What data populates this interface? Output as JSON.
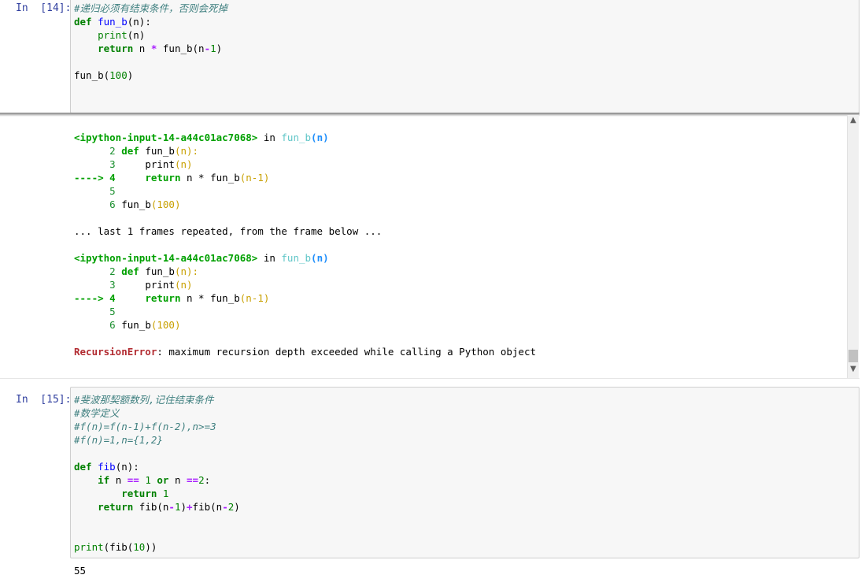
{
  "cell14": {
    "prompt": "In  [14]:",
    "comment": "#递归必须有结束条件，否则会死掉",
    "def_kw": "def",
    "fn_name": "fun_b",
    "def_args": "(n):",
    "print_fn": "print",
    "print_args": "(n)",
    "return_kw": "return",
    "return_n": " n ",
    "star": "*",
    "return_call": " fun_b(n",
    "minus": "-",
    "one": "1",
    "close": ")",
    "call_name": "fun_b(",
    "call_arg": "100",
    "call_close": ")"
  },
  "traceback": {
    "frames": [
      {
        "header_file": "<ipython-input-14-a44c01ac7068>",
        "header_in": " in ",
        "header_fn": "fun_b",
        "header_args": "(n)",
        "lines": [
          {
            "num": "      2",
            "code_kw": "def",
            "code_rest": " fun_b",
            "code_paren": "(n):"
          },
          {
            "num": "      3",
            "code_kw": "",
            "code_rest": "     print",
            "code_paren": "(n)"
          },
          {
            "num": "----> 4",
            "code_kw": "     return",
            "code_rest": " n * fun_b",
            "code_paren": "(n-1)"
          },
          {
            "num": "      5",
            "code_kw": "",
            "code_rest": "",
            "code_paren": ""
          },
          {
            "num": "      6",
            "code_kw": "",
            "code_rest": " fun_b",
            "code_paren": "(100)"
          }
        ]
      },
      {
        "header_file": "<ipython-input-14-a44c01ac7068>",
        "header_in": " in ",
        "header_fn": "fun_b",
        "header_args": "(n)",
        "lines": [
          {
            "num": "      2",
            "code_kw": "def",
            "code_rest": " fun_b",
            "code_paren": "(n):"
          },
          {
            "num": "      3",
            "code_kw": "",
            "code_rest": "     print",
            "code_paren": "(n)"
          },
          {
            "num": "----> 4",
            "code_kw": "     return",
            "code_rest": " n * fun_b",
            "code_paren": "(n-1)"
          },
          {
            "num": "      5",
            "code_kw": "",
            "code_rest": "",
            "code_paren": ""
          },
          {
            "num": "      6",
            "code_kw": "",
            "code_rest": " fun_b",
            "code_paren": "(100)"
          }
        ]
      }
    ],
    "repeat_note": "... last 1 frames repeated, from the frame below ...",
    "error_name": "RecursionError",
    "error_msg": ": maximum recursion depth exceeded while calling a Python object"
  },
  "cell15": {
    "prompt": "In  [15]:",
    "comment1": "#斐波那契额数列,记住结束条件",
    "comment2": "#数学定义",
    "comment3": "#f(n)=f(n-1)+f(n-2),n>=3",
    "comment4": "#f(n)=1,n={1,2}",
    "def_kw": "def",
    "fn_name": "fib",
    "def_args": "(n):",
    "if_kw": "if",
    "if_n": " n ",
    "eq1": "==",
    "num1": " 1 ",
    "or_kw": "or",
    "if_n2": " n ",
    "eq2": "==",
    "num2": "2",
    "colon": ":",
    "return_kw1": "return",
    "return_num": " 1",
    "return_kw2": "return",
    "fib_call1": " fib(n",
    "minus1": "-",
    "one1": "1",
    "close1": ")",
    "plus": "+",
    "fib_call2": "fib(n",
    "minus2": "-",
    "two2": "2",
    "close2": ")",
    "print_fn": "print",
    "print_open": "(fib(",
    "print_num": "10",
    "print_close": "))",
    "output": "55"
  }
}
